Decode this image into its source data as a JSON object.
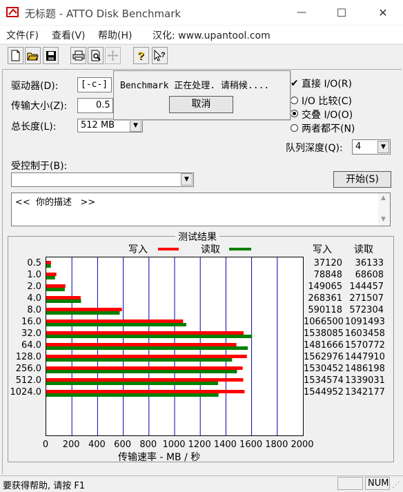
{
  "window": {
    "title": "无标题 - ATTO Disk Benchmark",
    "min_glyph": "—",
    "max_glyph": "☐",
    "close_glyph": "✕"
  },
  "menu": [
    "文件(F)",
    "查看(V)",
    "帮助(H)",
    "汉化: www.upantool.com"
  ],
  "toolbar": {
    "icons": [
      "new-document-icon",
      "open-folder-icon",
      "save-disk-icon",
      "print-icon",
      "print-preview-icon",
      "move-crosshair-icon",
      "help-question-icon",
      "context-help-icon"
    ]
  },
  "form": {
    "drive_label": "驱动器(D):",
    "drive_value": "[-c-]",
    "transfer_size_label": "传输大小(Z):",
    "transfer_size_value": "0.5",
    "total_length_label": "总长度(L):",
    "total_length_value": "512 MB",
    "direct_io_label": "直接 I/O(R)",
    "direct_io_checked": true,
    "io_compare_label": "I/O 比较(C)",
    "overlapped_io_label": "交叠 I/O(O)",
    "neither_label": "两者都不(N)",
    "selected_io_mode": "overlapped",
    "queue_depth_label": "队列深度(Q):",
    "queue_depth_value": "4",
    "controlled_by_label": "受控制于(B):",
    "controlled_by_value": "",
    "start_button": "开始(S)",
    "description_text": "<<  你的描述   >>"
  },
  "dialog": {
    "message": "Benchmark 正在处理.  请稍候....",
    "cancel_button": "取消"
  },
  "results": {
    "group_title": "测试结果",
    "legend_write": "写入",
    "legend_read": "读取",
    "col_write": "写入",
    "col_read": "读取",
    "xaxis_title": "传输速率 - MB / 秒",
    "write_color": "#ff0000",
    "read_color": "#008000",
    "grid_color": "#0000b0"
  },
  "chart_data": {
    "type": "bar",
    "orientation": "horizontal",
    "categories": [
      "0.5",
      "1.0",
      "2.0",
      "4.0",
      "8.0",
      "16.0",
      "32.0",
      "64.0",
      "128.0",
      "256.0",
      "512.0",
      "1024.0"
    ],
    "series": [
      {
        "name": "写入",
        "values": [
          37120,
          78848,
          149065,
          268361,
          590118,
          1066500,
          1538085,
          1481666,
          1562976,
          1530452,
          1534574,
          1544952
        ]
      },
      {
        "name": "读取",
        "values": [
          36133,
          68608,
          144457,
          271507,
          572304,
          1091493,
          1603458,
          1570772,
          1447910,
          1486198,
          1339031,
          1342177
        ]
      }
    ],
    "xticks": [
      "0",
      "200",
      "400",
      "600",
      "800",
      "1000",
      "1200",
      "1400",
      "1600",
      "1800",
      "2000"
    ],
    "xlim": [
      0,
      2000
    ],
    "xlabel": "传输速率 - MB / 秒",
    "value_unit_divisor": 1000,
    "grid": true
  },
  "status": {
    "help_text": "要获得帮助, 请按 F1",
    "indicator": "NUM"
  }
}
